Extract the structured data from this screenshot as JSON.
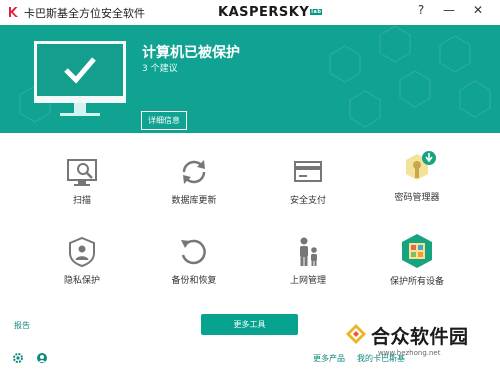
{
  "window": {
    "title": "卡巴斯基全方位安全软件",
    "controls": [
      "?",
      "—",
      "✕"
    ]
  },
  "brand": {
    "name": "KASPERSKY",
    "lab": "lab",
    "accent": "#11a392"
  },
  "status": {
    "title": "计算机已被保护",
    "subtitle": "3 个建议",
    "details_label": "详细信息"
  },
  "tiles": [
    {
      "label": "扫描",
      "icon": "scan-icon"
    },
    {
      "label": "数据库更新",
      "icon": "update-icon"
    },
    {
      "label": "安全支付",
      "icon": "safe-money-icon"
    },
    {
      "label": "密码管理器",
      "icon": "password-manager-icon"
    },
    {
      "label": "隐私保护",
      "icon": "privacy-icon"
    },
    {
      "label": "备份和恢复",
      "icon": "backup-icon"
    },
    {
      "label": "上网管理",
      "icon": "parental-control-icon"
    },
    {
      "label": "保护所有设备",
      "icon": "protect-devices-icon"
    }
  ],
  "bottom": {
    "report_label": "报告",
    "more_tools_label": "更多工具",
    "more_products_label": "更多产品",
    "my_kaspersky_label": "我的卡巴斯基"
  },
  "watermark": {
    "name": "合众软件园",
    "url": "www.hezhong.net"
  }
}
